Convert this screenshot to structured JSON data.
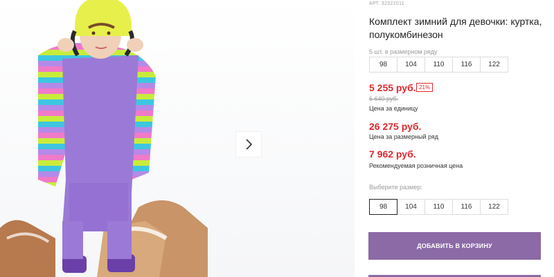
{
  "product": {
    "article": "АРТ. 32322011",
    "title": "Комплект зимний для девочки: куртка, полукомбинезон",
    "pack_note": "5 шт. в размерном ряду",
    "pack_sizes": [
      "98",
      "104",
      "110",
      "116",
      "122"
    ],
    "price_unit": "5 255 руб.",
    "discount": "21%",
    "old_price": "6 640 руб.",
    "price_unit_label": "Цена за единицу",
    "price_range": "26 275 руб.",
    "price_range_label": "Цена за размерный ряд",
    "price_retail": "7 962 руб.",
    "price_retail_label": "Рекомендуемая розничная цена",
    "choose_size_label": "Выберите размер:",
    "sizes": [
      "98",
      "104",
      "110",
      "116",
      "122"
    ],
    "selected_size": "98",
    "add_to_cart_label": "ДОБАВИТЬ В КОРЗИНУ"
  },
  "colors": {
    "price": "#e0262d",
    "button": "#8b6aa6"
  },
  "icons": {
    "next": "chevron-right-icon"
  }
}
